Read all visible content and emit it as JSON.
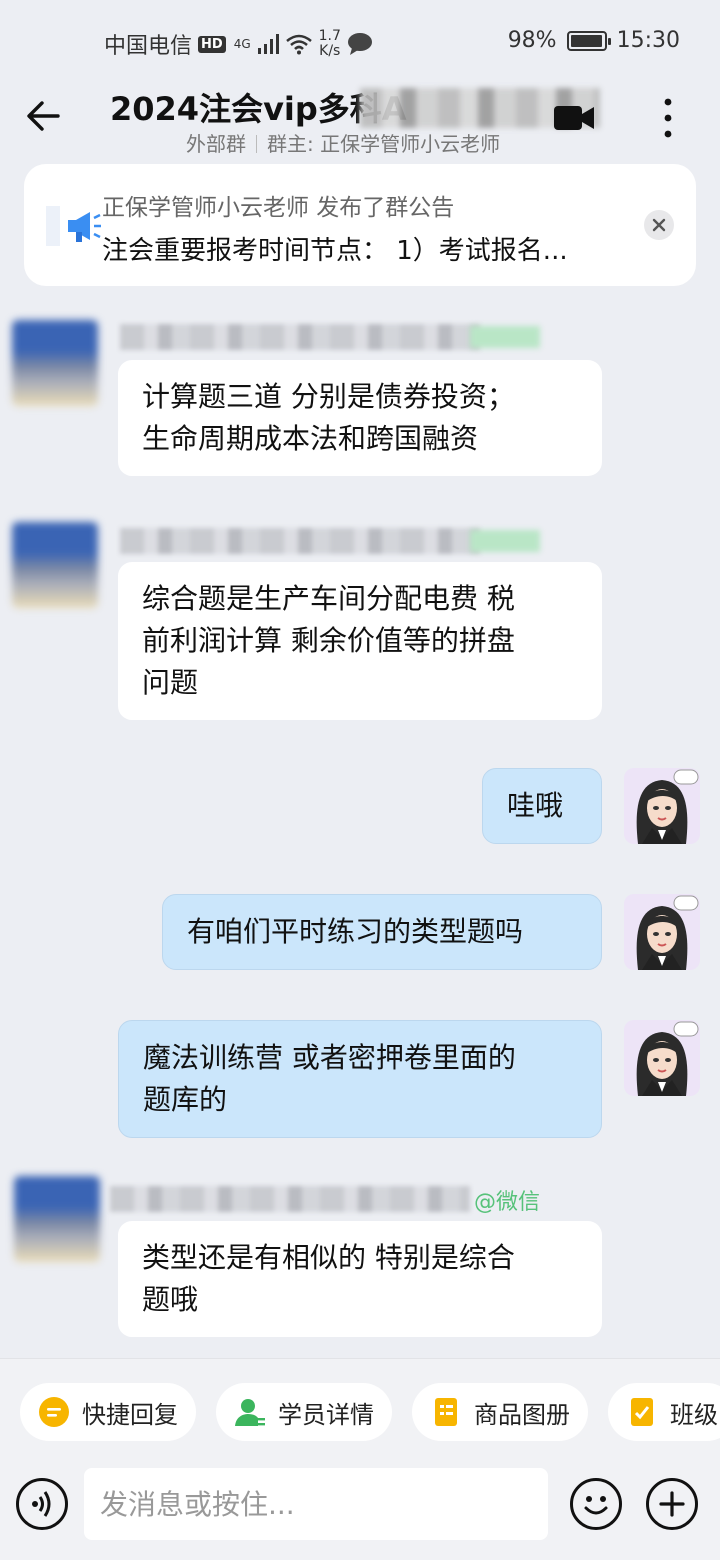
{
  "status_bar": {
    "carrier": "中国电信",
    "hd": "HD",
    "network": "4G",
    "speed_value": "1.7",
    "speed_unit": "K/s",
    "battery": "98%",
    "battery_level": 0.98,
    "time": "15:30"
  },
  "header": {
    "title": "2024注会vip多科A",
    "group_type": "外部群",
    "owner": "群主: 正保学管师小云老师"
  },
  "notice": {
    "line1": "正保学管师小云老师 发布了群公告",
    "line2": "注会重要报考时间节点： 1）考试报名..."
  },
  "messages": [
    {
      "side": "in",
      "text_lines": [
        "计算题三道 分别是债券投资；",
        "生命周期成本法和跨国融资"
      ]
    },
    {
      "side": "in",
      "text_lines": [
        "综合题是生产车间分配电费 税",
        "前利润计算 剩余价值等的拼盘",
        "问题"
      ]
    },
    {
      "side": "out",
      "text_lines": [
        "哇哦"
      ]
    },
    {
      "side": "out",
      "text_lines": [
        "有咱们平时练习的类型题吗"
      ]
    },
    {
      "side": "out",
      "text_lines": [
        "魔法训练营 或者密押卷里面的",
        "题库的"
      ]
    },
    {
      "side": "in",
      "sender_tag": "@微信",
      "text_lines": [
        "类型还是有相似的 特别是综合",
        "题哦"
      ]
    }
  ],
  "quick_actions": [
    {
      "label": "快捷回复",
      "icon": "quick-reply-icon",
      "color": "#f7b500"
    },
    {
      "label": "学员详情",
      "icon": "student-icon",
      "color": "#3bb55d"
    },
    {
      "label": "商品图册",
      "icon": "catalog-icon",
      "color": "#f7b500"
    },
    {
      "label": "班级",
      "icon": "class-icon",
      "color": "#f7b500"
    }
  ],
  "input": {
    "placeholder": "发消息或按住..."
  }
}
